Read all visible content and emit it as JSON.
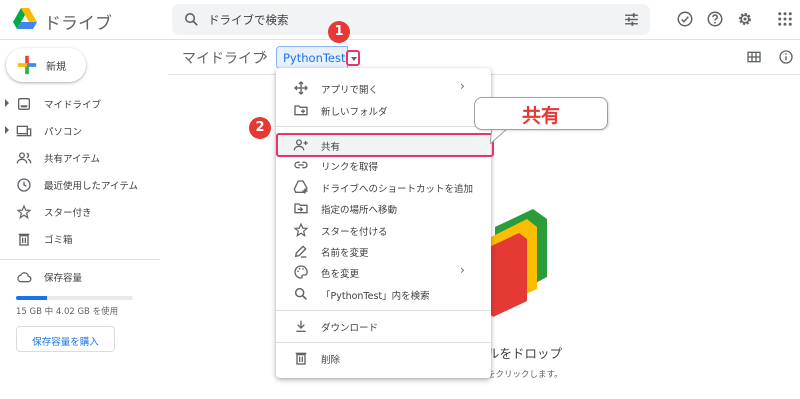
{
  "app": {
    "name": "ドライブ"
  },
  "search": {
    "placeholder": "ドライブで検索"
  },
  "sidebar": {
    "new_label": "新規",
    "items": [
      {
        "label": "マイドライブ",
        "icon": "my-drive-icon",
        "expandable": true
      },
      {
        "label": "パソコン",
        "icon": "computers-icon",
        "expandable": true
      },
      {
        "label": "共有アイテム",
        "icon": "shared-icon",
        "expandable": false
      },
      {
        "label": "最近使用したアイテム",
        "icon": "recent-icon",
        "expandable": false
      },
      {
        "label": "スター付き",
        "icon": "star-icon",
        "expandable": false
      },
      {
        "label": "ゴミ箱",
        "icon": "trash-icon",
        "expandable": false
      }
    ],
    "storage": {
      "label": "保存容量",
      "usage_text": "15 GB 中 4.02 GB を使用",
      "used_fraction": 0.268,
      "buy_label": "保存容量を購入"
    }
  },
  "breadcrumb": {
    "root": "マイドライブ",
    "separator": "›",
    "current": "PythonTest"
  },
  "main": {
    "drop_text": "ルをドロップ",
    "drop_sub": "をクリックします。"
  },
  "context_menu": {
    "items": [
      {
        "label": "アプリで開く",
        "icon": "open-with-icon",
        "submenu": true
      },
      {
        "label": "新しいフォルダ",
        "icon": "new-folder-icon",
        "submenu": false
      },
      {
        "label": "共有",
        "icon": "share-icon",
        "submenu": false,
        "highlighted": true
      },
      {
        "label": "リンクを取得",
        "icon": "link-icon",
        "submenu": false
      },
      {
        "label": "ドライブへのショートカットを追加",
        "icon": "add-shortcut-icon",
        "submenu": false
      },
      {
        "label": "指定の場所へ移動",
        "icon": "move-to-icon",
        "submenu": false
      },
      {
        "label": "スターを付ける",
        "icon": "star-icon",
        "submenu": false
      },
      {
        "label": "名前を変更",
        "icon": "rename-icon",
        "submenu": false
      },
      {
        "label": "色を変更",
        "icon": "palette-icon",
        "submenu": true
      },
      {
        "label": "「PythonTest」内を検索",
        "icon": "search-icon",
        "submenu": false
      },
      {
        "label": "ダウンロード",
        "icon": "download-icon",
        "submenu": false
      },
      {
        "label": "削除",
        "icon": "trash-icon",
        "submenu": false
      }
    ],
    "submenu_glyph": "›"
  },
  "annotations": {
    "step1": "1",
    "step2": "2",
    "callout": "共有"
  },
  "colors": {
    "accent": "#1a73e8",
    "highlight_border": "#e8336f",
    "badge": "#e53935"
  }
}
